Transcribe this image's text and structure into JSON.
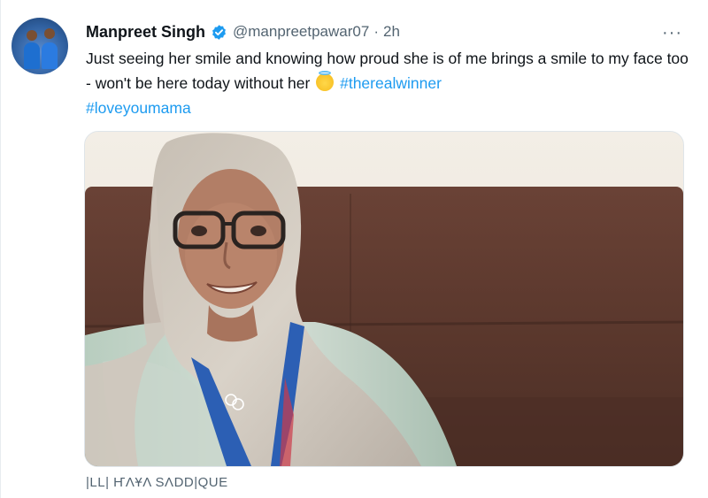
{
  "tweet": {
    "author_name": "Manpreet Singh",
    "handle": "@manpreetpawar07",
    "separator": "·",
    "time": "2h",
    "more_label": "···",
    "text_main": "Just seeing her smile and knowing how proud she is of me brings a smile to my face too - won't be here today without her",
    "hashtags": [
      "#therealwinner",
      "#loveyoumama"
    ],
    "icons": {
      "verified": "verified-badge-icon",
      "emoji": "smiling-face-with-halo-emoji",
      "more": "more-options-icon"
    },
    "colors": {
      "link": "#1d9bf0",
      "secondary": "#536471",
      "verified": "#1d9bf0"
    },
    "photo_alt": "Woman in a headscarf and glasses smiling, wearing an Olympic lanyard, seated on a brown sofa"
  },
  "watermark": "|LL| ҤΛҰΛ SΛDD|QUE"
}
